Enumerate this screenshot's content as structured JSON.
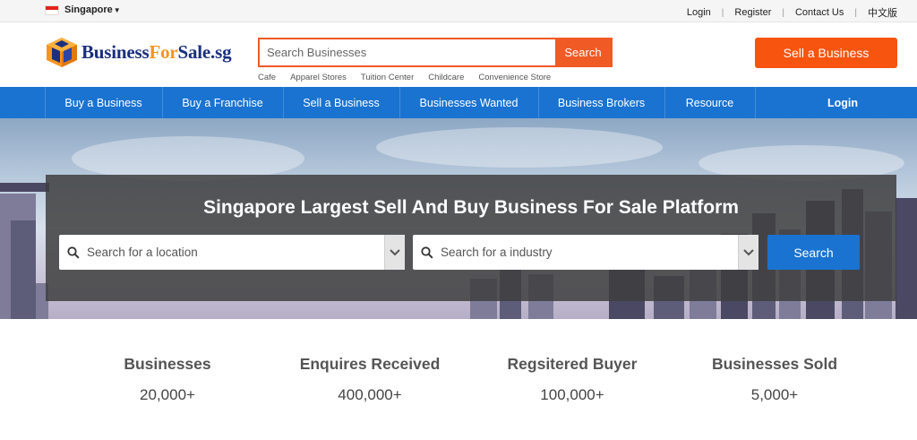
{
  "topbar": {
    "country": "Singapore",
    "links": [
      "Login",
      "Register",
      "Contact Us",
      "中文版"
    ]
  },
  "header": {
    "logo": {
      "part1": "Business",
      "part2": "For",
      "part3": "Sale.sg"
    },
    "search": {
      "placeholder": "Search Businesses",
      "button": "Search"
    },
    "popular": [
      "Cafe",
      "Apparel Stores",
      "Tuition Center",
      "Childcare",
      "Convenience Store"
    ],
    "sell_button": "Sell a Business"
  },
  "nav": {
    "items": [
      "Buy a Business",
      "Buy a Franchise",
      "Sell a Business",
      "Businesses Wanted",
      "Business Brokers",
      "Resource"
    ],
    "login": "Login"
  },
  "hero": {
    "title": "Singapore Largest Sell And Buy Business For Sale Platform",
    "location_placeholder": "Search for a location",
    "industry_placeholder": "Search for a industry",
    "search_button": "Search"
  },
  "stats": [
    {
      "label": "Businesses",
      "value": "20,000+"
    },
    {
      "label": "Enquires Received",
      "value": "400,000+"
    },
    {
      "label": "Regsitered Buyer",
      "value": "100,000+"
    },
    {
      "label": "Businesses Sold",
      "value": "5,000+"
    }
  ],
  "colors": {
    "accent": "#f05a24",
    "nav": "#1a73d0",
    "logo_blue": "#1b2f7e",
    "logo_orange": "#f7941d"
  }
}
